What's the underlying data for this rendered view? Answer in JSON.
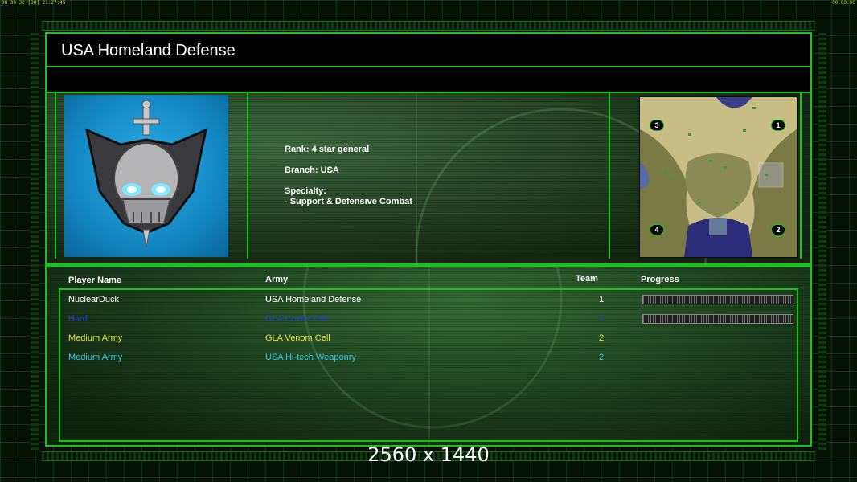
{
  "hud": {
    "left_text": "08 30 32 [30] 21:27:45",
    "right_text": "00:00:00"
  },
  "header": {
    "title": "USA Homeland Defense"
  },
  "general": {
    "rank": "Rank: 4 star general",
    "branch": "Branch: USA",
    "specialty_label": "Specialty:",
    "specialty_value": "- Support & Defensive Combat",
    "emblem_icon": "skull-sword-emblem-icon",
    "emblem_bg_color": "#1a93d1"
  },
  "minimap": {
    "start_positions": [
      "3",
      "1",
      "4",
      "2"
    ]
  },
  "table": {
    "columns": {
      "player": "Player Name",
      "army": "Army",
      "team": "Team",
      "progress": "Progress"
    },
    "rows": [
      {
        "player": "NuclearDuck",
        "army": "USA Homeland Defense",
        "team": "1",
        "color": "#ffffff",
        "has_progress": true
      },
      {
        "player": "Hard",
        "army": "GLA Covert Cell",
        "team": "1",
        "color": "#1e3fd0",
        "has_progress": true
      },
      {
        "player": "Medium Army",
        "army": "GLA Venom Cell",
        "team": "2",
        "color": "#e6e03a",
        "has_progress": false
      },
      {
        "player": "Medium Army",
        "army": "USA Hi-tech Weaponry",
        "team": "2",
        "color": "#3ac8e6",
        "has_progress": false
      }
    ]
  },
  "overlay": {
    "resolution_label": "2560 x 1440"
  },
  "colors": {
    "frame_green": "#19c419"
  }
}
